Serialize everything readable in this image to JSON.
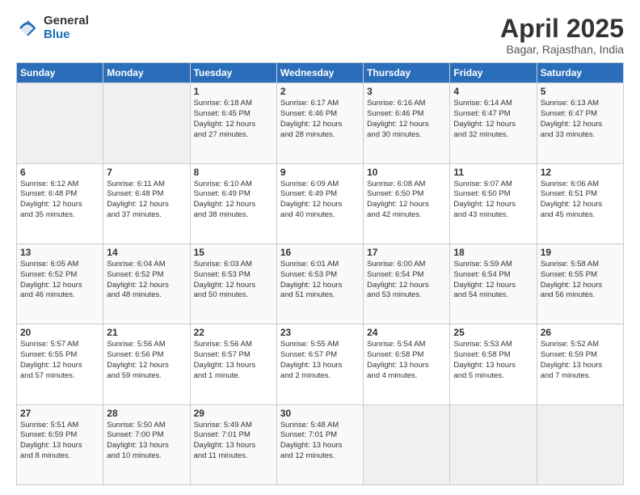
{
  "header": {
    "logo_general": "General",
    "logo_blue": "Blue",
    "month_title": "April 2025",
    "location": "Bagar, Rajasthan, India"
  },
  "days_of_week": [
    "Sunday",
    "Monday",
    "Tuesday",
    "Wednesday",
    "Thursday",
    "Friday",
    "Saturday"
  ],
  "weeks": [
    [
      {
        "day": "",
        "info": ""
      },
      {
        "day": "",
        "info": ""
      },
      {
        "day": "1",
        "info": "Sunrise: 6:18 AM\nSunset: 6:45 PM\nDaylight: 12 hours\nand 27 minutes."
      },
      {
        "day": "2",
        "info": "Sunrise: 6:17 AM\nSunset: 6:46 PM\nDaylight: 12 hours\nand 28 minutes."
      },
      {
        "day": "3",
        "info": "Sunrise: 6:16 AM\nSunset: 6:46 PM\nDaylight: 12 hours\nand 30 minutes."
      },
      {
        "day": "4",
        "info": "Sunrise: 6:14 AM\nSunset: 6:47 PM\nDaylight: 12 hours\nand 32 minutes."
      },
      {
        "day": "5",
        "info": "Sunrise: 6:13 AM\nSunset: 6:47 PM\nDaylight: 12 hours\nand 33 minutes."
      }
    ],
    [
      {
        "day": "6",
        "info": "Sunrise: 6:12 AM\nSunset: 6:48 PM\nDaylight: 12 hours\nand 35 minutes."
      },
      {
        "day": "7",
        "info": "Sunrise: 6:11 AM\nSunset: 6:48 PM\nDaylight: 12 hours\nand 37 minutes."
      },
      {
        "day": "8",
        "info": "Sunrise: 6:10 AM\nSunset: 6:49 PM\nDaylight: 12 hours\nand 38 minutes."
      },
      {
        "day": "9",
        "info": "Sunrise: 6:09 AM\nSunset: 6:49 PM\nDaylight: 12 hours\nand 40 minutes."
      },
      {
        "day": "10",
        "info": "Sunrise: 6:08 AM\nSunset: 6:50 PM\nDaylight: 12 hours\nand 42 minutes."
      },
      {
        "day": "11",
        "info": "Sunrise: 6:07 AM\nSunset: 6:50 PM\nDaylight: 12 hours\nand 43 minutes."
      },
      {
        "day": "12",
        "info": "Sunrise: 6:06 AM\nSunset: 6:51 PM\nDaylight: 12 hours\nand 45 minutes."
      }
    ],
    [
      {
        "day": "13",
        "info": "Sunrise: 6:05 AM\nSunset: 6:52 PM\nDaylight: 12 hours\nand 46 minutes."
      },
      {
        "day": "14",
        "info": "Sunrise: 6:04 AM\nSunset: 6:52 PM\nDaylight: 12 hours\nand 48 minutes."
      },
      {
        "day": "15",
        "info": "Sunrise: 6:03 AM\nSunset: 6:53 PM\nDaylight: 12 hours\nand 50 minutes."
      },
      {
        "day": "16",
        "info": "Sunrise: 6:01 AM\nSunset: 6:53 PM\nDaylight: 12 hours\nand 51 minutes."
      },
      {
        "day": "17",
        "info": "Sunrise: 6:00 AM\nSunset: 6:54 PM\nDaylight: 12 hours\nand 53 minutes."
      },
      {
        "day": "18",
        "info": "Sunrise: 5:59 AM\nSunset: 6:54 PM\nDaylight: 12 hours\nand 54 minutes."
      },
      {
        "day": "19",
        "info": "Sunrise: 5:58 AM\nSunset: 6:55 PM\nDaylight: 12 hours\nand 56 minutes."
      }
    ],
    [
      {
        "day": "20",
        "info": "Sunrise: 5:57 AM\nSunset: 6:55 PM\nDaylight: 12 hours\nand 57 minutes."
      },
      {
        "day": "21",
        "info": "Sunrise: 5:56 AM\nSunset: 6:56 PM\nDaylight: 12 hours\nand 59 minutes."
      },
      {
        "day": "22",
        "info": "Sunrise: 5:56 AM\nSunset: 6:57 PM\nDaylight: 13 hours\nand 1 minute."
      },
      {
        "day": "23",
        "info": "Sunrise: 5:55 AM\nSunset: 6:57 PM\nDaylight: 13 hours\nand 2 minutes."
      },
      {
        "day": "24",
        "info": "Sunrise: 5:54 AM\nSunset: 6:58 PM\nDaylight: 13 hours\nand 4 minutes."
      },
      {
        "day": "25",
        "info": "Sunrise: 5:53 AM\nSunset: 6:58 PM\nDaylight: 13 hours\nand 5 minutes."
      },
      {
        "day": "26",
        "info": "Sunrise: 5:52 AM\nSunset: 6:59 PM\nDaylight: 13 hours\nand 7 minutes."
      }
    ],
    [
      {
        "day": "27",
        "info": "Sunrise: 5:51 AM\nSunset: 6:59 PM\nDaylight: 13 hours\nand 8 minutes."
      },
      {
        "day": "28",
        "info": "Sunrise: 5:50 AM\nSunset: 7:00 PM\nDaylight: 13 hours\nand 10 minutes."
      },
      {
        "day": "29",
        "info": "Sunrise: 5:49 AM\nSunset: 7:01 PM\nDaylight: 13 hours\nand 11 minutes."
      },
      {
        "day": "30",
        "info": "Sunrise: 5:48 AM\nSunset: 7:01 PM\nDaylight: 13 hours\nand 12 minutes."
      },
      {
        "day": "",
        "info": ""
      },
      {
        "day": "",
        "info": ""
      },
      {
        "day": "",
        "info": ""
      }
    ]
  ]
}
